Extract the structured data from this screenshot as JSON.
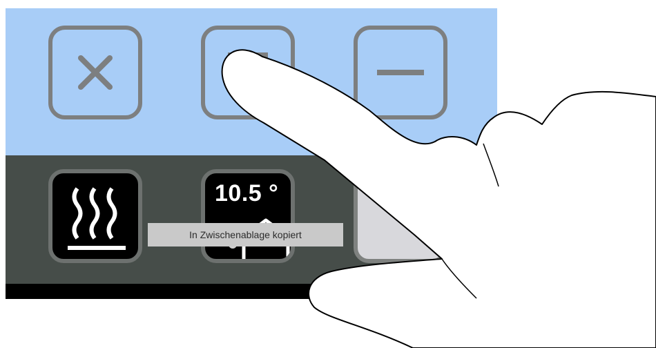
{
  "toolbar": {
    "close_icon": "close-icon",
    "maximize_icon": "square-icon",
    "minimize_icon": "minus-icon"
  },
  "tiles": {
    "heating_icon": "heat-waves-icon",
    "temperature": "10.5 °",
    "thermometer_icon": "thermometer-icon",
    "house_icon": "house-icon"
  },
  "toast": {
    "text": "In Zwischenablage kopiert"
  },
  "home": {
    "icon": "home-icon"
  },
  "colors": {
    "top_band": "#a8cdf7",
    "mid_band": "#464d49",
    "border_gray": "#7d7f80",
    "tile_black": "#000000"
  }
}
